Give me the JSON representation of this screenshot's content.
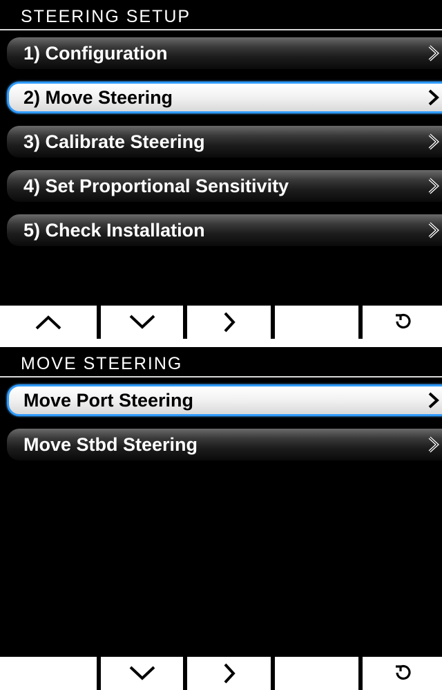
{
  "screen1": {
    "title": "STEERING SETUP",
    "menu": [
      {
        "label": "1) Configuration",
        "selected": false
      },
      {
        "label": "2) Move Steering",
        "selected": true
      },
      {
        "label": "3) Calibrate Steering",
        "selected": false
      },
      {
        "label": "4) Set Proportional Sensitivity",
        "selected": false
      },
      {
        "label": "5) Check Installation",
        "selected": false
      }
    ],
    "softkeys": [
      "up-arrow-icon",
      "down-arrow-icon",
      "right-arrow-icon",
      "blank",
      "back-icon"
    ]
  },
  "screen2": {
    "title": "MOVE STEERING",
    "menu": [
      {
        "label": "Move Port Steering",
        "selected": true
      },
      {
        "label": "Move Stbd Steering",
        "selected": false
      }
    ],
    "softkeys": [
      "blank",
      "down-arrow-icon",
      "right-arrow-icon",
      "blank",
      "back-icon"
    ]
  },
  "colors": {
    "background": "#000000",
    "selection_border": "#2f9bff",
    "selected_fill": "#f1f1f1",
    "item_fill": "#3a3a3a",
    "softkey_fill": "#ffffff"
  }
}
